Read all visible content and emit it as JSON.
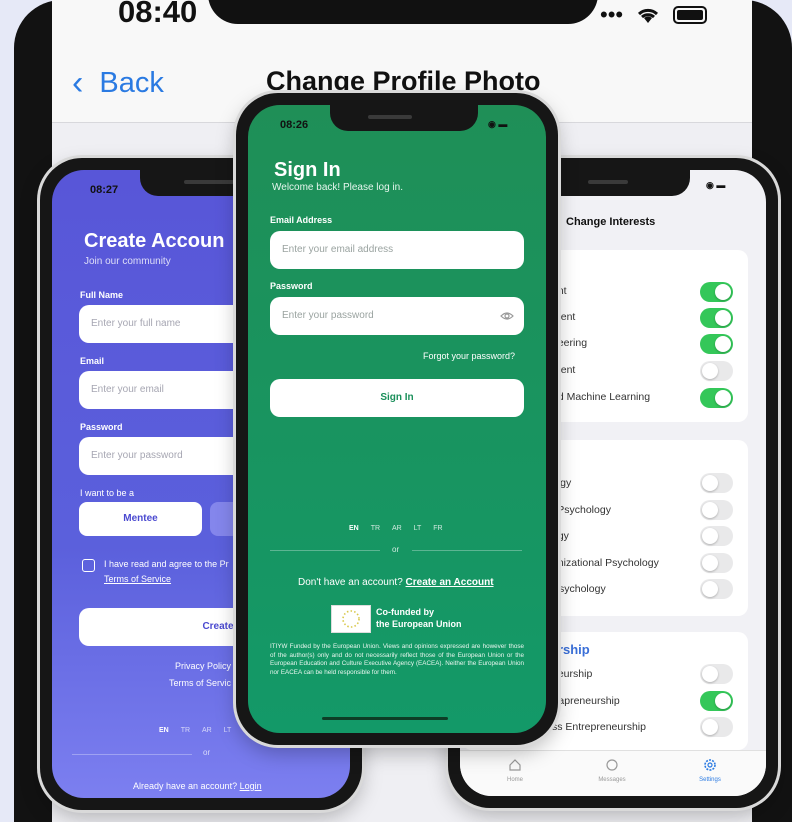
{
  "background_screen": {
    "time": "08:40",
    "back_label": "Back",
    "title": "Change Profile Photo"
  },
  "left_phone": {
    "time": "08:27",
    "title": "Create Accoun",
    "subtitle": "Join our community",
    "full_name_label": "Full Name",
    "full_name_placeholder": "Enter your full name",
    "email_label": "Email",
    "email_placeholder": "Enter your email",
    "password_label": "Password",
    "password_placeholder": "Enter your password",
    "role_label": "I want to be a",
    "role_mentee": "Mentee",
    "terms_text": "I have read and agree to the Pr",
    "terms_link": "Terms of Service",
    "create_button": "Create Accou",
    "privacy_policy": "Privacy Policy",
    "terms_of_service": "Terms of Servic",
    "languages": [
      "EN",
      "TR",
      "AR",
      "LT"
    ],
    "or": "or",
    "already_text": "Already have an account?",
    "login_link": "Login"
  },
  "center_phone": {
    "time": "08:26",
    "title": "Sign In",
    "subtitle": "Welcome back! Please log in.",
    "email_label": "Email Address",
    "email_placeholder": "Enter your email address",
    "password_label": "Password",
    "password_placeholder": "Enter your password",
    "forgot_password": "Forgot your password?",
    "sign_in_button": "Sign In",
    "languages": [
      "EN",
      "TR",
      "AR",
      "LT",
      "FR"
    ],
    "or": "or",
    "no_account_text": "Don't have an account?",
    "create_account_link": "Create an Account",
    "eu_line1": "Co-funded by",
    "eu_line2": "the European Union",
    "disclaimer": "ITIYW Funded by the European Union. Views and opinions expressed are however those of the author(s) only and do not necessarily reflect those of the European Union or the European Education and Culture Executive Agency (EACEA). Neither the European Union nor EACEA can be held responsible for them."
  },
  "right_phone": {
    "title": "Change Interests",
    "section1_items": [
      {
        "label": "ent",
        "on": true
      },
      {
        "label": "ment",
        "on": true
      },
      {
        "label": "neering",
        "on": true
      },
      {
        "label": "ment",
        "on": false
      },
      {
        "label": "nd Machine Learning",
        "on": true
      }
    ],
    "section2_header": "/",
    "section2_items": [
      {
        "label": "logy",
        "on": false
      },
      {
        "label": "l Psychology",
        "on": false
      },
      {
        "label": "ogy",
        "on": false
      },
      {
        "label": "anizational Psychology",
        "on": false
      },
      {
        "label": "Psychology",
        "on": false
      }
    ],
    "section3_header": "urship",
    "section3_items": [
      {
        "label": "neurship",
        "on": false
      },
      {
        "label": "trapreneurship",
        "on": true
      },
      {
        "label": "ss Entrepreneurship",
        "on": false
      }
    ],
    "tabs": [
      "Home",
      "Messages",
      "Settings"
    ]
  }
}
